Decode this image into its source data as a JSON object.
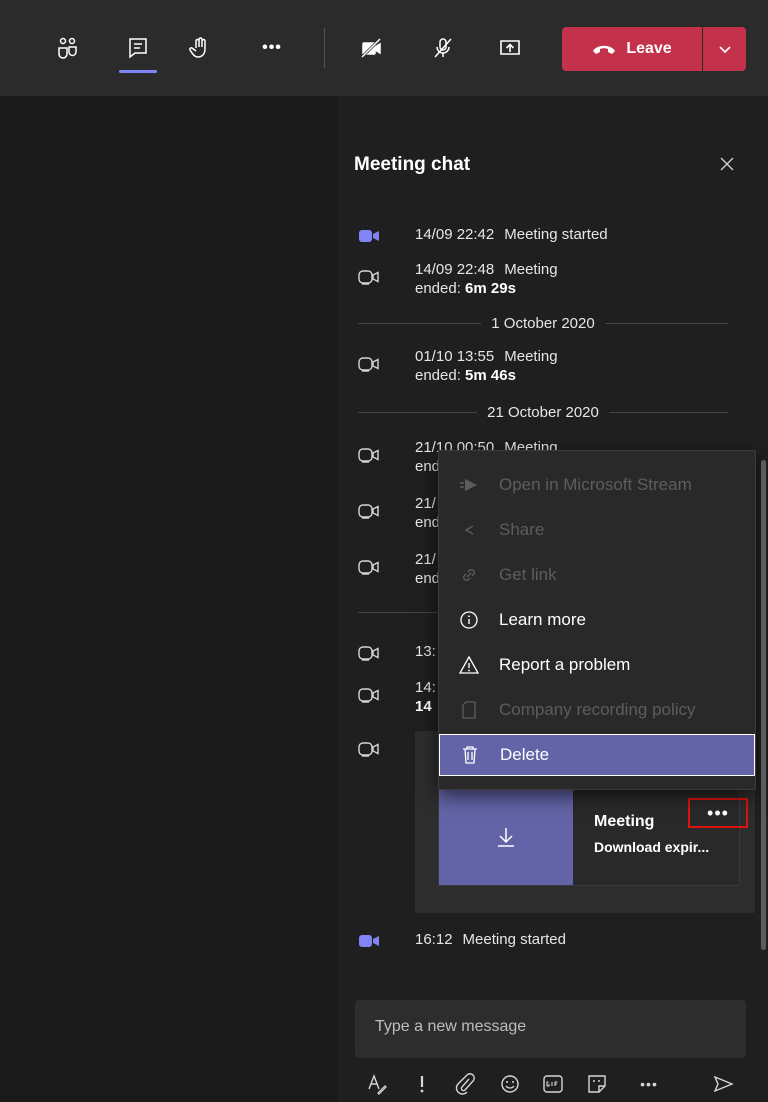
{
  "toolbar": {
    "leave_label": "Leave",
    "more_dots": "•••"
  },
  "chat": {
    "title": "Meeting chat",
    "events": [
      {
        "time": "14/09 22:42",
        "text": "Meeting started",
        "duration": ""
      },
      {
        "time": "14/09 22:48",
        "text": "Meeting",
        "line2": "ended: ",
        "duration": "6m 29s"
      },
      {
        "time": "01/10 13:55",
        "text": "Meeting",
        "line2": "ended: ",
        "duration": "5m 46s"
      },
      {
        "time": "21/10 00:50",
        "text": "Meeting",
        "line2": "end"
      },
      {
        "time": "21/",
        "line2": "end"
      },
      {
        "time": "21/",
        "line2": "end"
      },
      {
        "time": "13:",
        "line2": ""
      },
      {
        "time": "14:",
        "line2": "14"
      },
      {
        "time": "16:12",
        "text": "Meeting started"
      }
    ],
    "date_separators": [
      "1 October 2020",
      "21 October 2020"
    ],
    "recording": {
      "title": "Meeting",
      "subtitle": "Download expir..."
    },
    "more_dots": "•••"
  },
  "context_menu": {
    "items": [
      {
        "label": "Open in Microsoft Stream",
        "disabled": true,
        "icon": "stream-icon"
      },
      {
        "label": "Share",
        "disabled": true,
        "icon": "share-icon"
      },
      {
        "label": "Get link",
        "disabled": true,
        "icon": "link-icon"
      },
      {
        "label": "Learn more",
        "disabled": false,
        "icon": "info-icon"
      },
      {
        "label": "Report a problem",
        "disabled": false,
        "icon": "warning-icon"
      },
      {
        "label": "Company recording policy",
        "disabled": true,
        "icon": "document-icon"
      },
      {
        "label": "Delete",
        "disabled": false,
        "active": true,
        "icon": "trash-icon"
      }
    ]
  },
  "compose": {
    "placeholder": "Type a new message",
    "more_dots": "•••"
  },
  "colors": {
    "accent": "#6264a7",
    "leave": "#c4314b",
    "highlight_box": "#e0120f"
  }
}
